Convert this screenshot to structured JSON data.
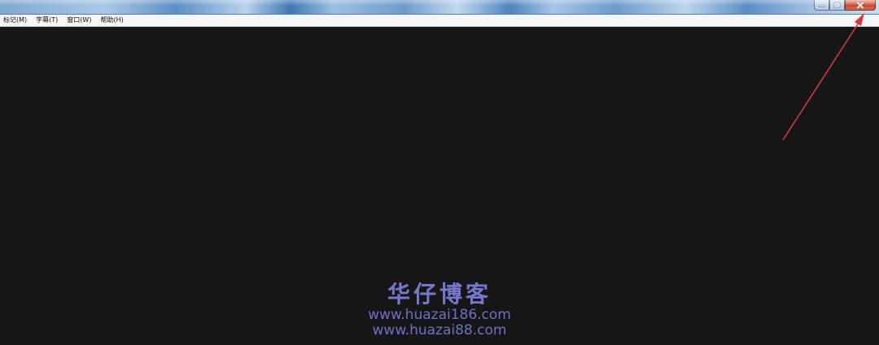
{
  "window": {
    "controls": {
      "minimize_icon": "minimize-icon",
      "maximize_icon": "maximize-icon",
      "close_icon": "close-icon"
    }
  },
  "menubar": {
    "items": [
      {
        "label": "标记(M)"
      },
      {
        "label": "字幕(T)"
      },
      {
        "label": "窗口(W)"
      },
      {
        "label": "帮助(H)"
      }
    ]
  },
  "annotation": {
    "arrow_color": "#d23b3b"
  },
  "watermark": {
    "title": "华仔博客",
    "url1": "www.huazai186.com",
    "url2": "www.huazai88.com",
    "color": "#7478cf"
  }
}
